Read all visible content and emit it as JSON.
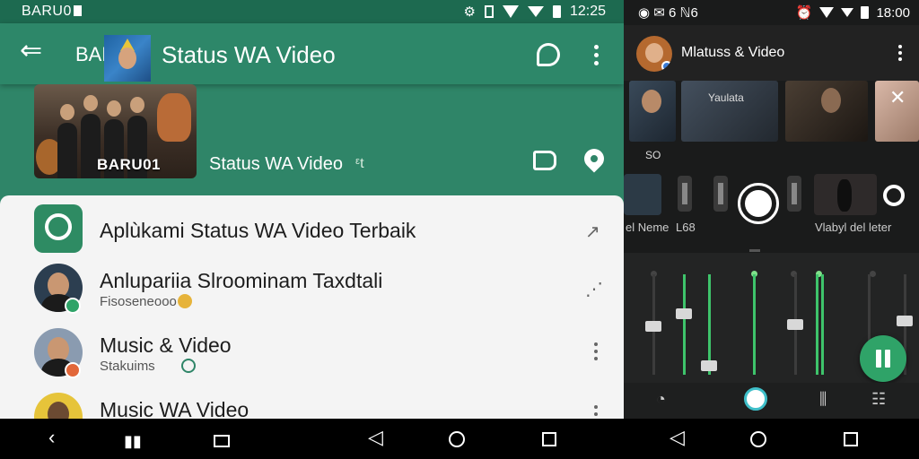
{
  "left": {
    "statusbar": {
      "carrier": "BARU0",
      "time": "12:25"
    },
    "appbar": {
      "brand": "BARU",
      "title": "Status WA Video"
    },
    "banner": {
      "thumb_label": "BARU01",
      "title": "Status WA Video",
      "mark": "ᵋt"
    },
    "list": [
      {
        "title": "Aplùkami Status WA Video Terbaik",
        "sub": ""
      },
      {
        "title": "Anlupariia Slroominam Taxdtali",
        "sub": "Fisoseneooo"
      },
      {
        "title": "Music & Video",
        "sub": "Stakuims"
      },
      {
        "title": "Music WA Video",
        "sub": ""
      }
    ]
  },
  "right": {
    "statusbar": {
      "left": "6 ℕ6",
      "time": "18:00"
    },
    "appbar": {
      "title": "Mlatuss & Video"
    },
    "strip": {
      "label_a": "SO",
      "label_b": "Yaulata"
    },
    "controls": {
      "label_left_1": "el Neme",
      "label_left_2": "L68",
      "label_right": "Vlabyl del leter"
    }
  },
  "colors": {
    "primary": "#2f8568",
    "primary_dark": "#1d6a50",
    "accent_green": "#2fa368",
    "mixer_green": "#3ec46b"
  },
  "icons": [
    "back-arrow-icon",
    "chat-icon",
    "more-vert-icon",
    "share-icon",
    "pin-icon",
    "share-nodes-icon",
    "close-icon",
    "record-icon",
    "pause-icon",
    "nav-back-icon",
    "nav-home-icon",
    "nav-recents-icon"
  ]
}
